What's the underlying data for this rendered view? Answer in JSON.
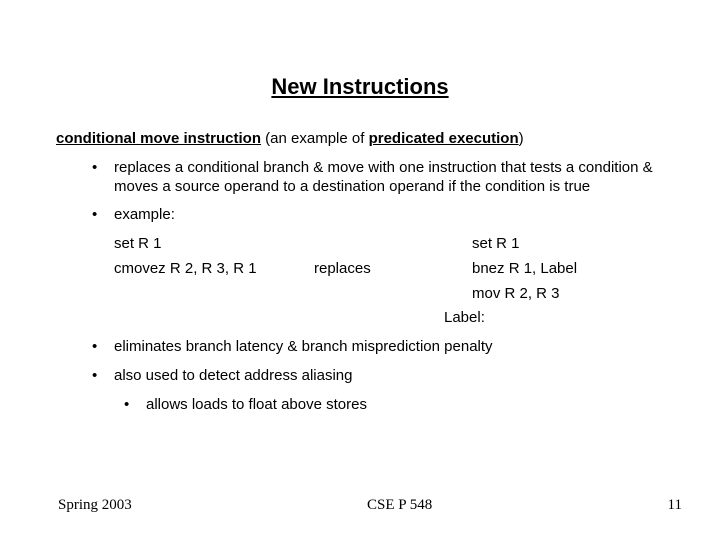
{
  "title": "New Instructions",
  "main": {
    "prefix": "conditional move instruction",
    "mid": " (an example of ",
    "term": "predicated execution",
    "suffix": ")"
  },
  "bullets": {
    "b1": "replaces a conditional branch & move with one instruction that tests a condition & moves a source operand to a destination operand if the condition is true",
    "b2": "example:",
    "b3": "eliminates branch latency & branch misprediction penalty",
    "b4": "also used to detect address aliasing",
    "b4a": "allows loads to float above stores"
  },
  "example": {
    "row1": {
      "left": "set R 1",
      "mid": "",
      "right": "set R 1"
    },
    "row2": {
      "left": "cmovez R 2, R 3, R 1",
      "mid": "replaces",
      "right": "bnez R 1, Label"
    },
    "row3": {
      "left": "",
      "mid": "",
      "right": "mov R 2, R 3"
    },
    "label": "Label:"
  },
  "footer": {
    "left": "Spring 2003",
    "center": "CSE P 548",
    "right": "11"
  }
}
